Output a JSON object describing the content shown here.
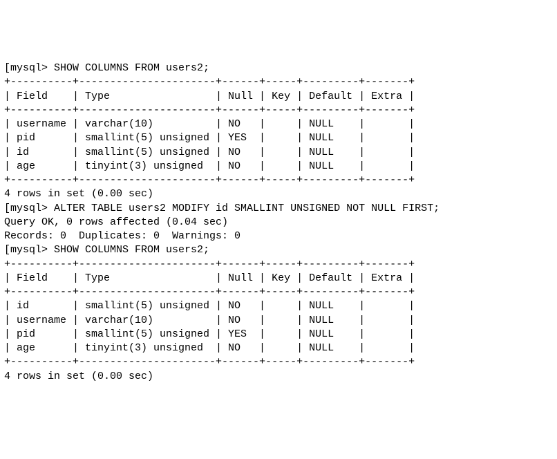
{
  "prompt": "mysql>",
  "commands": {
    "show1": "SHOW COLUMNS FROM users2;",
    "alter": "ALTER TABLE users2 MODIFY id SMALLINT UNSIGNED NOT NULL FIRST;",
    "show2": "SHOW COLUMNS FROM users2;"
  },
  "headers": [
    "Field",
    "Type",
    "Null",
    "Key",
    "Default",
    "Extra"
  ],
  "table1_rows": [
    {
      "Field": "username",
      "Type": "varchar(10)",
      "Null": "NO",
      "Key": "",
      "Default": "NULL",
      "Extra": ""
    },
    {
      "Field": "pid",
      "Type": "smallint(5) unsigned",
      "Null": "YES",
      "Key": "",
      "Default": "NULL",
      "Extra": ""
    },
    {
      "Field": "id",
      "Type": "smallint(5) unsigned",
      "Null": "NO",
      "Key": "",
      "Default": "NULL",
      "Extra": ""
    },
    {
      "Field": "age",
      "Type": "tinyint(3) unsigned",
      "Null": "NO",
      "Key": "",
      "Default": "NULL",
      "Extra": ""
    }
  ],
  "table2_rows": [
    {
      "Field": "id",
      "Type": "smallint(5) unsigned",
      "Null": "NO",
      "Key": "",
      "Default": "NULL",
      "Extra": ""
    },
    {
      "Field": "username",
      "Type": "varchar(10)",
      "Null": "NO",
      "Key": "",
      "Default": "NULL",
      "Extra": ""
    },
    {
      "Field": "pid",
      "Type": "smallint(5) unsigned",
      "Null": "YES",
      "Key": "",
      "Default": "NULL",
      "Extra": ""
    },
    {
      "Field": "age",
      "Type": "tinyint(3) unsigned",
      "Null": "NO",
      "Key": "",
      "Default": "NULL",
      "Extra": ""
    }
  ],
  "result1_footer": "4 rows in set (0.00 sec)",
  "alter_result_line1": "Query OK, 0 rows affected (0.04 sec)",
  "alter_result_line2": "Records: 0  Duplicates: 0  Warnings: 0",
  "result2_footer": "4 rows in set (0.00 sec)",
  "col_widths": {
    "Field": 10,
    "Type": 22,
    "Null": 6,
    "Key": 5,
    "Default": 9,
    "Extra": 7
  }
}
